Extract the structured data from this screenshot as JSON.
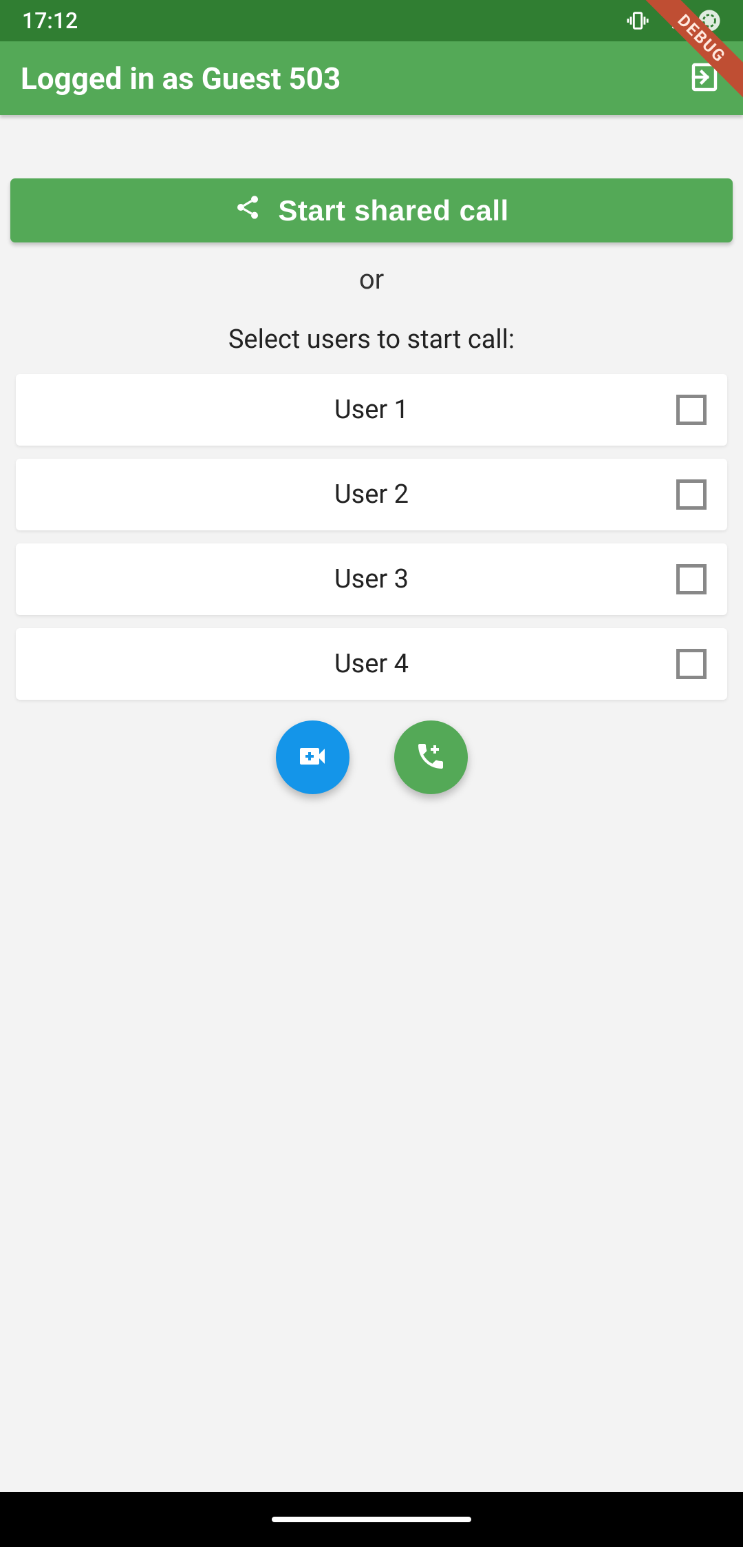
{
  "status": {
    "time": "17:12"
  },
  "appbar": {
    "title": "Logged in as Guest 503"
  },
  "debug_banner": "DEBUG",
  "actions": {
    "shared_call": "Start shared call",
    "or": "or",
    "select_prompt": "Select users to start call:"
  },
  "users": [
    {
      "name": "User 1",
      "checked": false
    },
    {
      "name": "User 2",
      "checked": false
    },
    {
      "name": "User 3",
      "checked": false
    },
    {
      "name": "User 4",
      "checked": false
    }
  ]
}
